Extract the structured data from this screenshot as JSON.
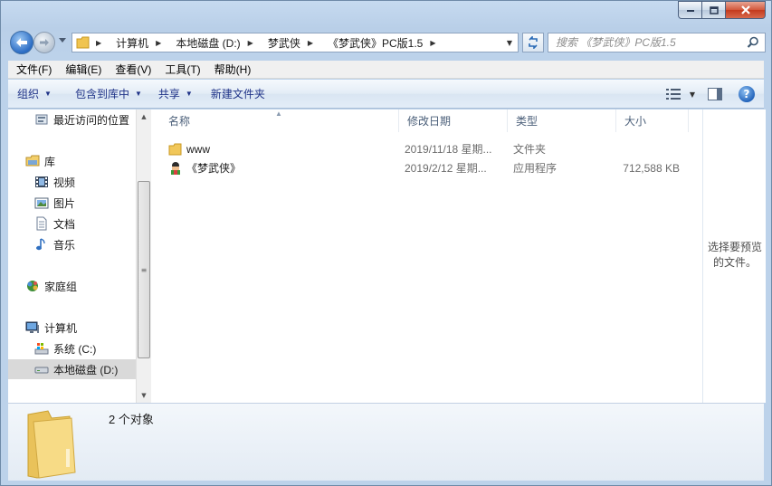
{
  "window": {
    "caption_buttons": [
      "minimize-icon",
      "maximize-icon",
      "close-icon"
    ]
  },
  "address_bar": {
    "breadcrumbs": [
      "计算机",
      "本地磁盘 (D:)",
      "梦武侠",
      "《梦武侠》PC版1.5"
    ]
  },
  "search": {
    "placeholder": "搜索 《梦武侠》PC版1.5"
  },
  "menubar": {
    "items": [
      "文件(F)",
      "编辑(E)",
      "查看(V)",
      "工具(T)",
      "帮助(H)"
    ]
  },
  "toolbar": {
    "organize": "组织",
    "include_in_library": "包含到库中",
    "share": "共享",
    "new_folder": "新建文件夹"
  },
  "nav_pane": {
    "recent": "最近访问的位置",
    "libraries": "库",
    "videos": "视频",
    "pictures": "图片",
    "documents": "文档",
    "music": "音乐",
    "homegroup": "家庭组",
    "computer": "计算机",
    "drive_c": "系统 (C:)",
    "drive_d": "本地磁盘 (D:)"
  },
  "columns": {
    "name": "名称",
    "date": "修改日期",
    "type": "类型",
    "size": "大小"
  },
  "files": [
    {
      "name": "www",
      "date": "2019/11/18 星期...",
      "type": "文件夹",
      "size": "",
      "icon": "folder-icon"
    },
    {
      "name": "《梦武侠》",
      "date": "2019/2/12 星期...",
      "type": "应用程序",
      "size": "712,588 KB",
      "icon": "app-icon"
    }
  ],
  "preview": {
    "message_line1": "选择要预览",
    "message_line2": "的文件。"
  },
  "details": {
    "count": "2 个对象"
  }
}
